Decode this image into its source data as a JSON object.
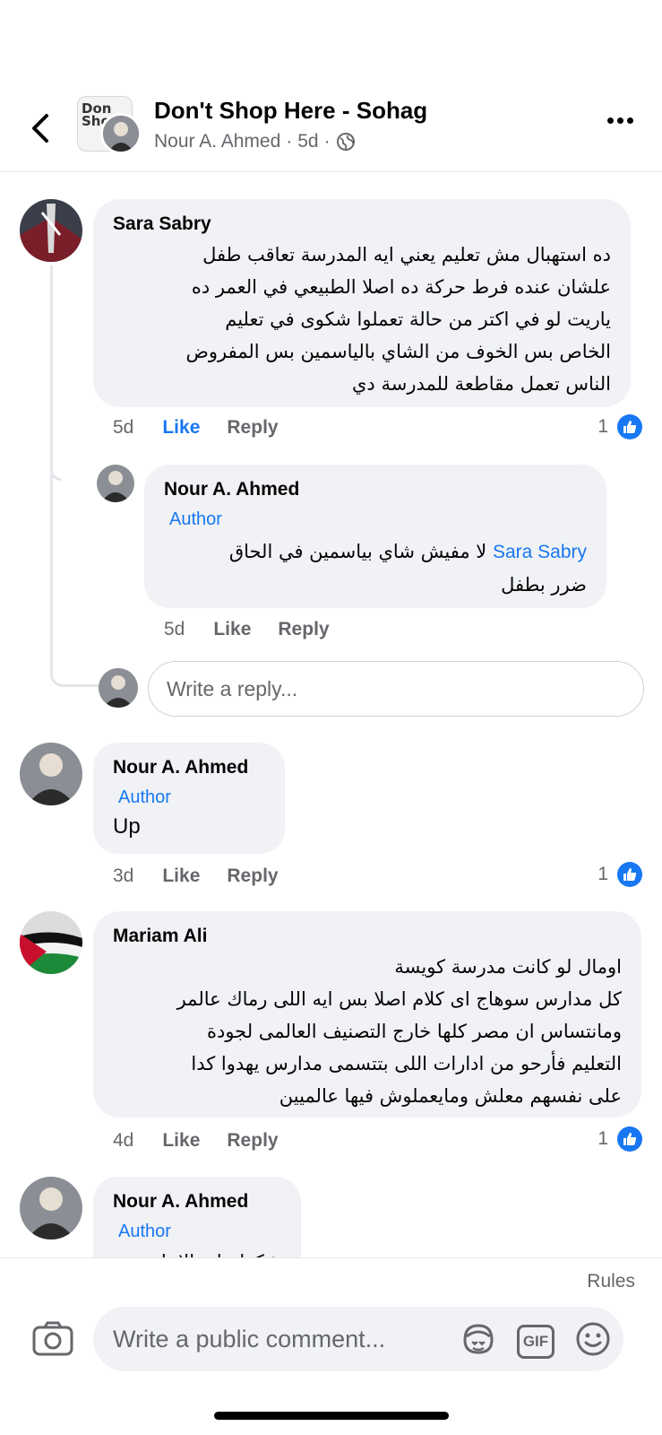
{
  "header": {
    "title": "Don't Shop Here - Sohag",
    "author": "Nour A. Ahmed",
    "separator": "·",
    "time": "5d",
    "logo_text": "Don Shop"
  },
  "comments": [
    {
      "name": "Sara Sabry",
      "lines": [
        "ده استهبال مش تعليم يعني ايه المدرسة تعاقب طفل",
        "علشان عنده فرط حركة ده اصلا الطبيعي في العمر ده",
        "ياريت لو في اكتر من حالة تعملوا شكوى في تعليم",
        "الخاص بس الخوف من الشاي بالياسمين بس المفروض",
        "الناس تعمل مقاطعة للمدرسة دي"
      ],
      "time": "5d",
      "like": "Like",
      "reply": "Reply",
      "reactions": "1"
    },
    {
      "name": "Nour A. Ahmed",
      "badge": "Author",
      "mention": "Sara Sabry",
      "lines": [
        "لا مفيش شاي بياسمين في الحاق",
        "ضرر بطفل"
      ],
      "time": "5d",
      "like": "Like",
      "reply": "Reply"
    },
    {
      "name": "Nour A. Ahmed",
      "badge": "Author",
      "text": "Up",
      "time": "3d",
      "like": "Like",
      "reply": "Reply",
      "reactions": "1"
    },
    {
      "name": "Mariam Ali",
      "lines": [
        "اومال لو كانت مدرسة كويسة",
        "كل مدارس سوهاج اى كلام اصلا بس ايه اللى رماك عالمر",
        "ومانتساس ان مصر كلها خارج التصنيف العالمى لجودة",
        "التعليم فأرحو من ادارات اللى بتتسمى مدارس يهدوا كدا",
        "على نفسهم معلش ومايعملوش فيها عالميين"
      ],
      "time": "4d",
      "like": "Like",
      "reply": "Reply",
      "reactions": "1"
    },
    {
      "name": "Nour A. Ahmed",
      "badge": "Author",
      "partial": "شكرا على الاجابة"
    }
  ],
  "reply_input": {
    "placeholder": "Write a reply..."
  },
  "bottom": {
    "rules": "Rules",
    "comment_placeholder": "Write a public comment...",
    "gif_label": "GIF"
  },
  "colors": {
    "accent": "#1877f2",
    "bubble": "#f0f2f5",
    "muted": "#65676b"
  }
}
